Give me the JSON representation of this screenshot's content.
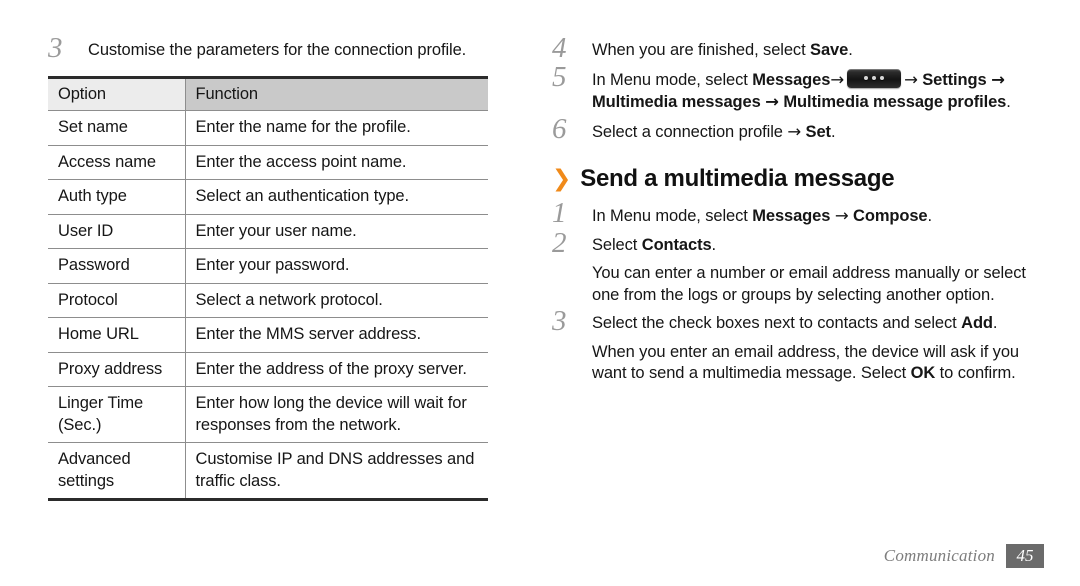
{
  "document": {
    "footer_label": "Communication",
    "page_number": "45",
    "accent_color": "#f08a1a",
    "badge_color": "#6b6b6b"
  },
  "left_column": {
    "step": {
      "number": "3",
      "text": "Customise the parameters for the connection profile."
    },
    "table": {
      "headers": [
        "Option",
        "Function"
      ],
      "rows": [
        {
          "option": "Set name",
          "function": "Enter the name for the profile."
        },
        {
          "option": "Access name",
          "function": "Enter the access point name."
        },
        {
          "option": "Auth type",
          "function": "Select an authentication type."
        },
        {
          "option": "User ID",
          "function": "Enter your user name."
        },
        {
          "option": "Password",
          "function": "Enter your password."
        },
        {
          "option": "Protocol",
          "function": "Select a network protocol."
        },
        {
          "option": "Home URL",
          "function": "Enter the MMS server address."
        },
        {
          "option": "Proxy address",
          "function": "Enter the address of the proxy server."
        },
        {
          "option": "Linger Time (Sec.)",
          "function": "Enter how long the device will wait for responses from the network."
        },
        {
          "option": "Advanced settings",
          "function": "Customise IP and DNS addresses and traffic class."
        }
      ]
    }
  },
  "right_column": {
    "steps_top": [
      {
        "number": "4",
        "prefix": "When you are finished, select ",
        "bold1": "Save",
        "suffix": "."
      },
      {
        "number": "5",
        "prefix": "In Menu mode, select ",
        "bold1": "Messages",
        "arrow1": "→",
        "icon": "more-options-key-icon",
        "arrow2": "→",
        "bold2": "Settings",
        "arrow3": "→",
        "bold3": "Multimedia messages",
        "arrow4": "→",
        "bold4": "Multimedia message profiles",
        "suffix": "."
      },
      {
        "number": "6",
        "prefix": "Select a connection profile ",
        "arrow1": "→",
        "bold1": "Set",
        "suffix": "."
      }
    ],
    "section": {
      "chevron": "❯",
      "title": "Send a multimedia message"
    },
    "steps_bottom": [
      {
        "number": "1",
        "prefix": "In Menu mode, select ",
        "bold1": "Messages",
        "arrow1": "→",
        "bold2": "Compose",
        "suffix": "."
      },
      {
        "number": "2",
        "prefix": "Select ",
        "bold1": "Contacts",
        "suffix": ".",
        "note": "You can enter a number or email address manually or select one from the logs or groups by selecting another option."
      },
      {
        "number": "3",
        "prefix": "Select the check boxes next to contacts and select ",
        "bold1": "Add",
        "suffix": ".",
        "note_prefix": "When you enter an email address, the device will ask if you want to send a multimedia message. Select ",
        "note_bold": "OK",
        "note_suffix": " to confirm."
      }
    ]
  }
}
